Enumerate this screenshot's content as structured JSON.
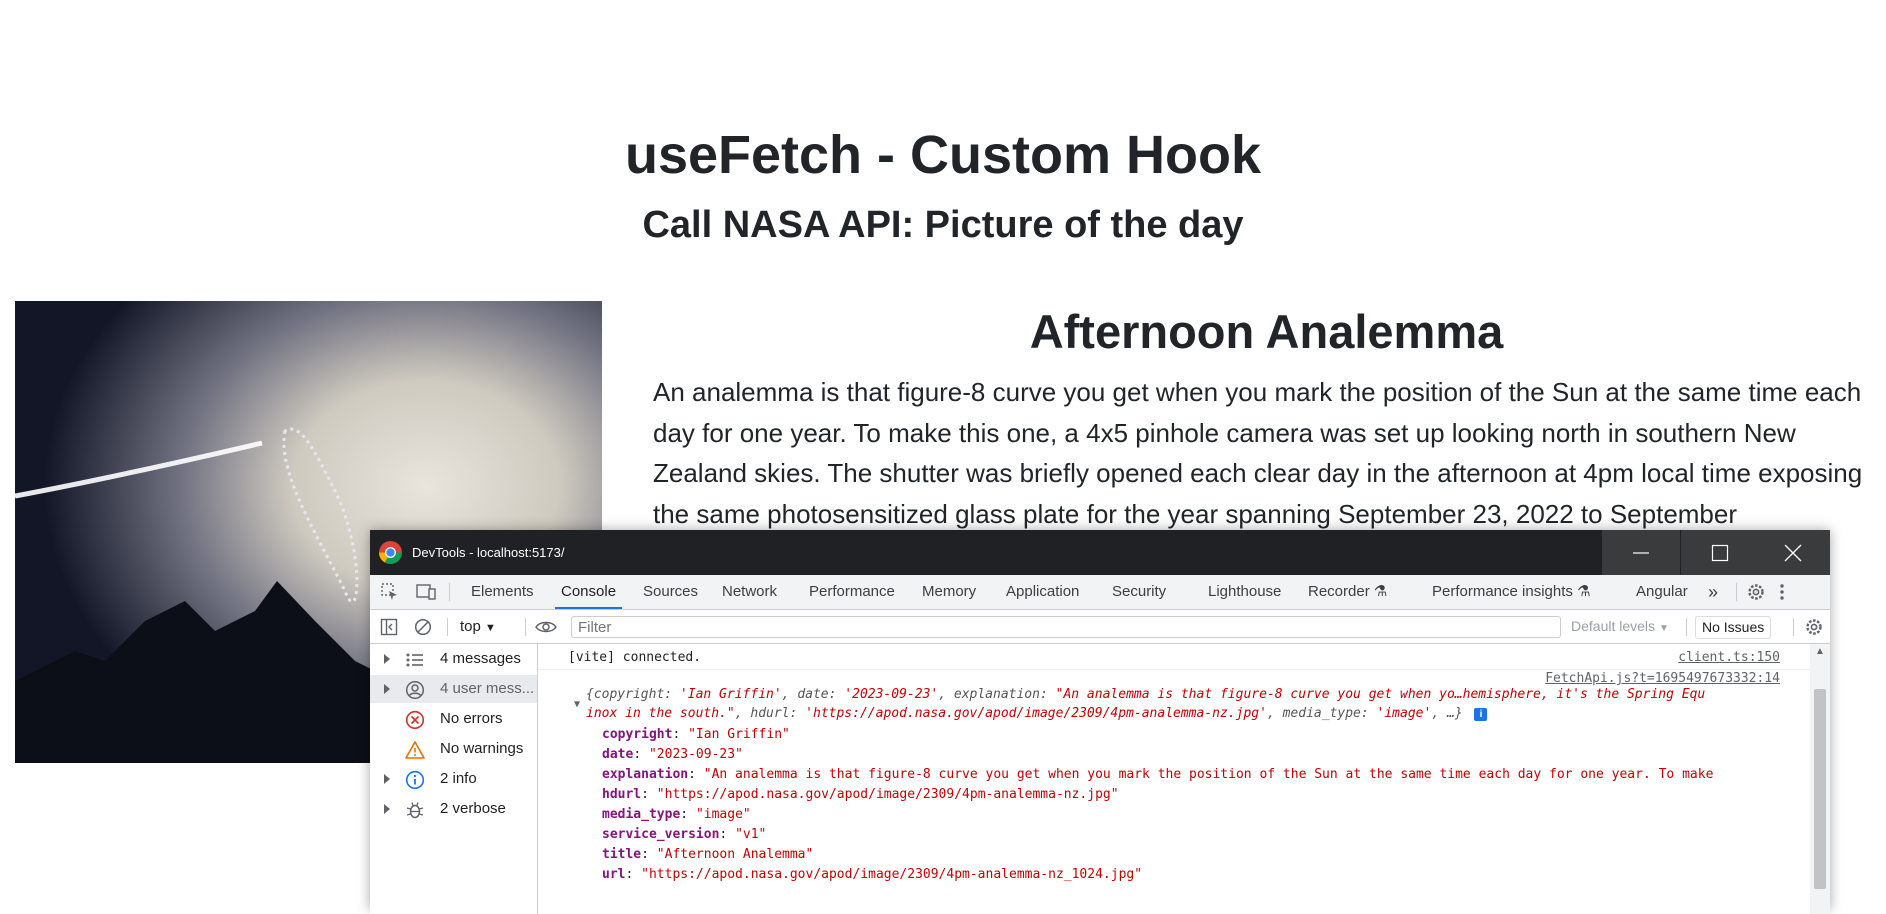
{
  "page": {
    "title": "useFetch - Custom Hook",
    "subtitle": "Call NASA API: Picture of the day"
  },
  "apod": {
    "title": "Afternoon Analemma",
    "explanation": "An analemma is that figure-8 curve you get when you mark the position of the Sun at the same time each day for one year. To make this one, a 4x5 pinhole camera was set up looking north in southern New Zealand skies. The shutter was briefly opened each clear day in the afternoon at 4pm local time exposing the same photosensitized glass plate for the year spanning September 23, 2022 to September"
  },
  "devtools": {
    "window_title": "DevTools - localhost:5173/",
    "tabs": [
      "Elements",
      "Console",
      "Sources",
      "Network",
      "Performance",
      "Memory",
      "Application",
      "Security",
      "Lighthouse",
      "Recorder",
      "Performance insights",
      "Angular"
    ],
    "context": "top",
    "filter_placeholder": "Filter",
    "levels": "Default levels",
    "issues": "No Issues",
    "sidebar": [
      {
        "label": "4 messages",
        "icon": "list-icon",
        "expandable": true
      },
      {
        "label": "4 user mess...",
        "icon": "user-icon",
        "expandable": true,
        "selected": true
      },
      {
        "label": "No errors",
        "icon": "error-icon",
        "expandable": false
      },
      {
        "label": "No warnings",
        "icon": "warning-icon",
        "expandable": false
      },
      {
        "label": "2 info",
        "icon": "info-icon",
        "expandable": true
      },
      {
        "label": "2 verbose",
        "icon": "bug-icon",
        "expandable": true
      }
    ],
    "console": {
      "vite_message": "[vite] connected.",
      "vite_source": "client.ts:150",
      "log_source": "FetchApi.js?t=1695497673332:14",
      "summary_line1_prefix": "{copyright: ",
      "summary_copyright": "'Ian Griffin'",
      "summary_date_key": ", date: ",
      "summary_date": "'2023-09-23'",
      "summary_expl_key": ", explanation: ",
      "summary_expl": "\"An analemma is that figure-8 curve you get when yo…hemisphere, it's the Spring Equ",
      "summary_line2_expl": "inox in the south.\"",
      "summary_hdurl_key": ", hdurl: ",
      "summary_hdurl": "'https://apod.nasa.gov/apod/image/2309/4pm-analemma-nz.jpg'",
      "summary_media_key": ", media_type: ",
      "summary_media": "'image'",
      "summary_end": ", …}",
      "info_badge": "i",
      "properties": [
        {
          "key": "copyright",
          "value": "\"Ian Griffin\""
        },
        {
          "key": "date",
          "value": "\"2023-09-23\""
        },
        {
          "key": "explanation",
          "value": "\"An analemma is that figure-8 curve you get when you mark the position of the Sun at the same time each day for one year. To make"
        },
        {
          "key": "hdurl",
          "value": "\"https://apod.nasa.gov/apod/image/2309/4pm-analemma-nz.jpg\""
        },
        {
          "key": "media_type",
          "value": "\"image\""
        },
        {
          "key": "service_version",
          "value": "\"v1\""
        },
        {
          "key": "title",
          "value": "\"Afternoon Analemma\""
        },
        {
          "key": "url",
          "value": "\"https://apod.nasa.gov/apod/image/2309/4pm-analemma-nz_1024.jpg\""
        }
      ]
    }
  },
  "colors": {
    "accent": "#1a73e8",
    "titlebar": "#202124",
    "console_key": "#881280",
    "console_string": "#c80000"
  }
}
